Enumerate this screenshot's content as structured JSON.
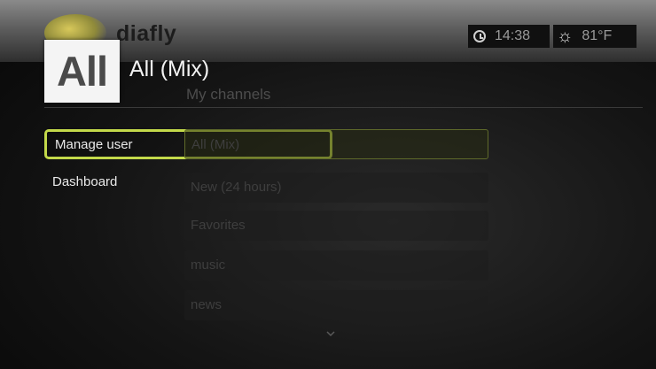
{
  "app": {
    "logo_text": "diafly"
  },
  "header": {
    "tile_label": "All",
    "channel_title": "All (Mix)"
  },
  "status": {
    "time": "14:38",
    "temperature": "81°F",
    "clock_icon": "clock-icon",
    "weather_icon": "sun-icon"
  },
  "section": {
    "label": "My channels"
  },
  "menu": [
    {
      "label": "Manage user",
      "selected": true
    },
    {
      "label": "Dashboard",
      "selected": false
    }
  ],
  "channels": [
    {
      "label": "All (Mix)"
    },
    {
      "label": "New (24 hours)"
    },
    {
      "label": "Favorites"
    },
    {
      "label": "music"
    },
    {
      "label": "news"
    }
  ],
  "colors": {
    "selection": "#c3d94a",
    "background": "#141414"
  }
}
